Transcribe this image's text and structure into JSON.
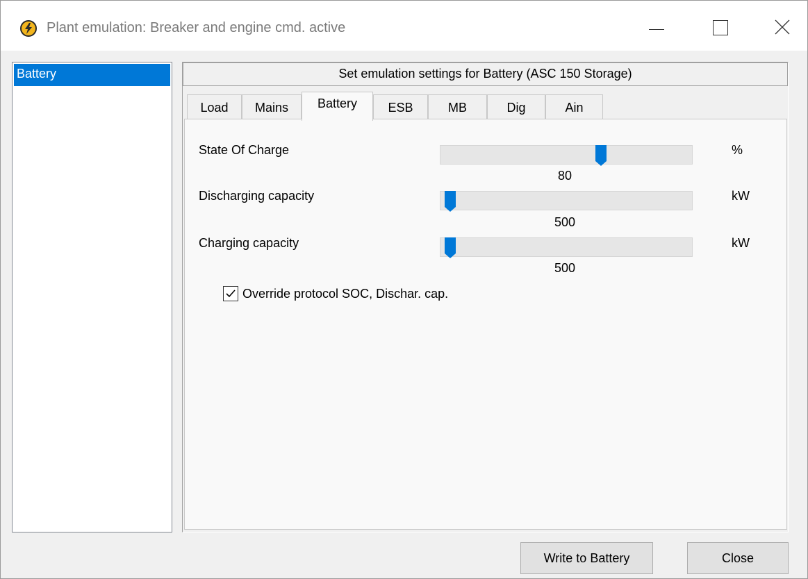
{
  "window": {
    "title": "Plant emulation: Breaker and engine cmd. active"
  },
  "tree": {
    "items": [
      {
        "label": "Battery",
        "selected": true
      }
    ]
  },
  "panel": {
    "header": "Set emulation settings for Battery (ASC 150 Storage)"
  },
  "tabs": [
    {
      "label": "Load"
    },
    {
      "label": "Mains"
    },
    {
      "label": "Battery",
      "active": true
    },
    {
      "label": "ESB"
    },
    {
      "label": "MB"
    },
    {
      "label": "Dig"
    },
    {
      "label": "Ain"
    }
  ],
  "settings": [
    {
      "label": "State Of Charge",
      "value": "80",
      "unit": "%",
      "slider_fraction": 0.65
    },
    {
      "label": "Discharging capacity",
      "value": "500",
      "unit": "kW",
      "slider_fraction": 0.0
    },
    {
      "label": "Charging capacity",
      "value": "500",
      "unit": "kW",
      "slider_fraction": 0.0
    }
  ],
  "override": {
    "label": "Override protocol SOC, Dischar. cap.",
    "checked": true
  },
  "buttons": {
    "write": "Write to Battery",
    "close": "Close"
  },
  "colors": {
    "accent": "#0078d7",
    "thumb": "#0078d7"
  },
  "icons": {
    "app": "lightning-bolt-icon",
    "minimize": "minimize-icon",
    "maximize": "maximize-icon",
    "close": "close-icon",
    "check": "checkmark-icon"
  }
}
